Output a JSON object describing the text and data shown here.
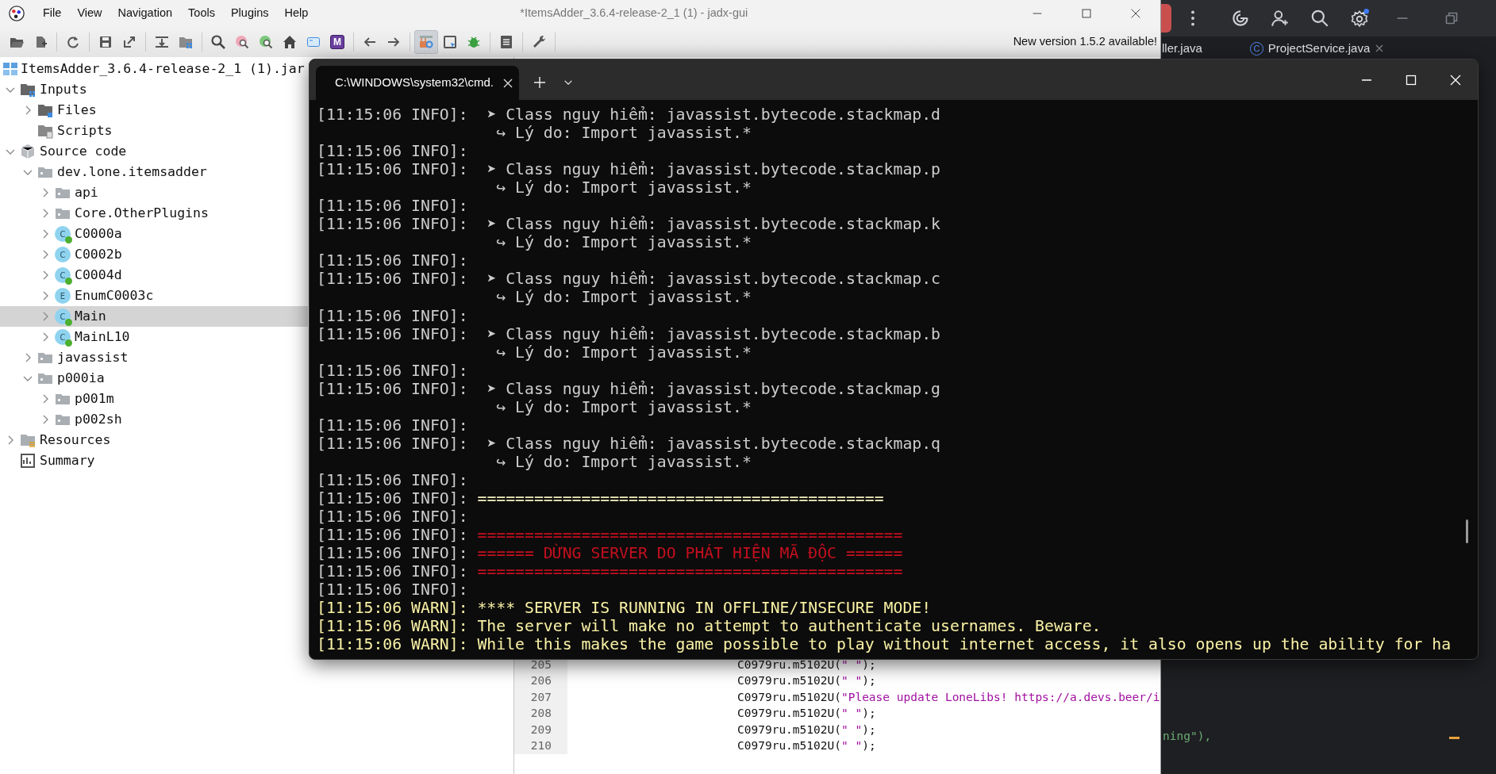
{
  "jadx": {
    "title": "*ItemsAdder_3.6.4-release-2_1 (1) - jadx-gui",
    "menu": [
      "File",
      "View",
      "Navigation",
      "Tools",
      "Plugins",
      "Help"
    ],
    "toolbar_badge": "M",
    "notice": "New version 1.5.2 available!",
    "tree": {
      "label": "ItemsAdder_3.6.4-release-2_1 (1).jar",
      "children": [
        {
          "label": "Inputs",
          "kind": "inputs",
          "expanded": true,
          "selected": false,
          "children": [
            {
              "label": "Files",
              "kind": "files",
              "expanded": false,
              "selected": false
            },
            {
              "label": "Scripts",
              "kind": "scripts",
              "selected": false
            }
          ]
        },
        {
          "label": "Source code",
          "kind": "source",
          "expanded": true,
          "selected": false,
          "children": [
            {
              "label": "dev.lone.itemsadder",
              "kind": "package",
              "expanded": true,
              "selected": false,
              "children": [
                {
                  "label": "api",
                  "kind": "package",
                  "expanded": false,
                  "selected": false
                },
                {
                  "label": "Core.OtherPlugins",
                  "kind": "package",
                  "expanded": false,
                  "selected": false
                },
                {
                  "label": "C0000a",
                  "kind": "class",
                  "badge": "C",
                  "dot": true,
                  "expanded": false,
                  "selected": false
                },
                {
                  "label": "C0002b",
                  "kind": "class",
                  "badge": "C",
                  "dot": false,
                  "expanded": false,
                  "selected": false
                },
                {
                  "label": "C0004d",
                  "kind": "class",
                  "badge": "C",
                  "dot": true,
                  "expanded": false,
                  "selected": false
                },
                {
                  "label": "EnumC0003c",
                  "kind": "class",
                  "badge": "E",
                  "dot": false,
                  "expanded": false,
                  "selected": false
                },
                {
                  "label": "Main",
                  "kind": "class",
                  "badge": "C",
                  "dot": true,
                  "expanded": false,
                  "selected": true
                },
                {
                  "label": "MainL10",
                  "kind": "class",
                  "badge": "C",
                  "dot": true,
                  "expanded": false,
                  "selected": false
                }
              ]
            },
            {
              "label": "javassist",
              "kind": "package",
              "expanded": false,
              "selected": false
            },
            {
              "label": "p000ia",
              "kind": "package",
              "expanded": true,
              "selected": false,
              "children": [
                {
                  "label": "p001m",
                  "kind": "package",
                  "expanded": false,
                  "selected": false
                },
                {
                  "label": "p002sh",
                  "kind": "package",
                  "expanded": false,
                  "selected": false
                }
              ]
            }
          ]
        },
        {
          "label": "Resources",
          "kind": "resources",
          "expanded": false,
          "selected": false
        },
        {
          "label": "Summary",
          "kind": "summary",
          "selected": false
        }
      ]
    },
    "code_lines": [
      {
        "number": "205",
        "call": "C0979ru.m5102U(",
        "string": "\" \"",
        "tail": ");"
      },
      {
        "number": "206",
        "call": "C0979ru.m5102U(",
        "string": "\" \"",
        "tail": ");"
      },
      {
        "number": "207",
        "call": "C0979ru.m5102U(",
        "string": "\"Please update LoneLibs! https://a.devs.beer/i"
      },
      {
        "number": "208",
        "call": "C0979ru.m5102U(",
        "string": "\" \"",
        "tail": ");"
      },
      {
        "number": "209",
        "call": "C0979ru.m5102U(",
        "string": "\" \"",
        "tail": ");"
      },
      {
        "number": "210",
        "call": "C0979ru.m5102U(",
        "string": "\" \"",
        "tail": ");"
      }
    ]
  },
  "ide": {
    "tabs": [
      {
        "label": "ller.java"
      },
      {
        "label": "ProjectService.java",
        "badge": "C"
      }
    ],
    "code_fragment": "ning\"),"
  },
  "terminal": {
    "tab": "C:\\WINDOWS\\system32\\cmd.",
    "lines": [
      {
        "kind": "info",
        "prefix": "[11:15:06 INFO]:",
        "text": "  ➤ Class nguy hiểm: javassist.bytecode.stackmap.d"
      },
      {
        "kind": "detail",
        "text": "↪ Lý do: Import javassist.*"
      },
      {
        "kind": "info",
        "prefix": "[11:15:06 INFO]:"
      },
      {
        "kind": "info",
        "prefix": "[11:15:06 INFO]:",
        "text": "  ➤ Class nguy hiểm: javassist.bytecode.stackmap.p"
      },
      {
        "kind": "detail",
        "text": "↪ Lý do: Import javassist.*"
      },
      {
        "kind": "info",
        "prefix": "[11:15:06 INFO]:"
      },
      {
        "kind": "info",
        "prefix": "[11:15:06 INFO]:",
        "text": "  ➤ Class nguy hiểm: javassist.bytecode.stackmap.k"
      },
      {
        "kind": "detail",
        "text": "↪ Lý do: Import javassist.*"
      },
      {
        "kind": "info",
        "prefix": "[11:15:06 INFO]:"
      },
      {
        "kind": "info",
        "prefix": "[11:15:06 INFO]:",
        "text": "  ➤ Class nguy hiểm: javassist.bytecode.stackmap.c"
      },
      {
        "kind": "detail",
        "text": "↪ Lý do: Import javassist.*"
      },
      {
        "kind": "info",
        "prefix": "[11:15:06 INFO]:"
      },
      {
        "kind": "info",
        "prefix": "[11:15:06 INFO]:",
        "text": "  ➤ Class nguy hiểm: javassist.bytecode.stackmap.b"
      },
      {
        "kind": "detail",
        "text": "↪ Lý do: Import javassist.*"
      },
      {
        "kind": "info",
        "prefix": "[11:15:06 INFO]:"
      },
      {
        "kind": "info",
        "prefix": "[11:15:06 INFO]:",
        "text": "  ➤ Class nguy hiểm: javassist.bytecode.stackmap.g"
      },
      {
        "kind": "detail",
        "text": "↪ Lý do: Import javassist.*"
      },
      {
        "kind": "info",
        "prefix": "[11:15:06 INFO]:"
      },
      {
        "kind": "info",
        "prefix": "[11:15:06 INFO]:",
        "text": "  ➤ Class nguy hiểm: javassist.bytecode.stackmap.q"
      },
      {
        "kind": "detail",
        "text": "↪ Lý do: Import javassist.*"
      },
      {
        "kind": "info",
        "prefix": "[11:15:06 INFO]:"
      },
      {
        "kind": "info",
        "prefix": "[11:15:06 INFO]:",
        "text": " ===========================================",
        "color": "#f4efc0"
      },
      {
        "kind": "info",
        "prefix": "[11:15:06 INFO]:"
      },
      {
        "kind": "info",
        "prefix": "[11:15:06 INFO]:",
        "text": " =============================================",
        "color": "#c50f1f"
      },
      {
        "kind": "info",
        "prefix": "[11:15:06 INFO]:",
        "text": " ====== DỪNG SERVER DO PHÁT HIỆN MÃ ĐỘC ======",
        "color": "#c50f1f"
      },
      {
        "kind": "info",
        "prefix": "[11:15:06 INFO]:",
        "text": " =============================================",
        "color": "#c50f1f"
      },
      {
        "kind": "info",
        "prefix": "[11:15:06 INFO]:"
      },
      {
        "kind": "warn",
        "prefix": "[11:15:06 WARN]:",
        "text": " **** SERVER IS RUNNING IN OFFLINE/INSECURE MODE!"
      },
      {
        "kind": "warn",
        "prefix": "[11:15:06 WARN]:",
        "text": " The server will make no attempt to authenticate usernames. Beware."
      },
      {
        "kind": "warn",
        "prefix": "[11:15:06 WARN]:",
        "text": " While this makes the game possible to play without internet access, it also opens up the ability for ha"
      }
    ]
  }
}
